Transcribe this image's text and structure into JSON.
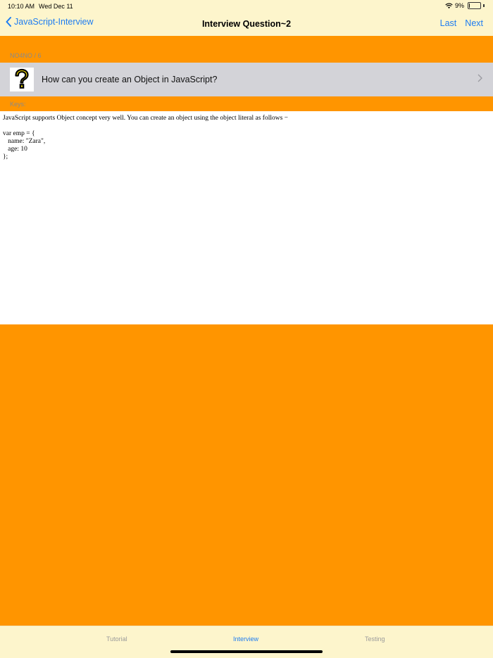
{
  "status": {
    "time": "10:10 AM",
    "date": "Wed Dec 11",
    "battery": "9%",
    "battery_level": 0.09
  },
  "nav": {
    "back_label": "JavaScript-Interview",
    "title": "Interview Question~2",
    "last_label": "Last",
    "next_label": "Next"
  },
  "section": {
    "counter": "NO4NO / 6",
    "keys_label": "Keys:"
  },
  "question": {
    "text": "How can you create an Object in JavaScript?",
    "icon": "question-mark-icon"
  },
  "answer": {
    "text": "JavaScript supports Object concept very well. You can create an object using the object literal as follows −\n\nvar emp = {\n   name: \"Zara\",\n   age: 10\n};"
  },
  "tabs": [
    {
      "label": "Tutorial",
      "active": false
    },
    {
      "label": "Interview",
      "active": true
    },
    {
      "label": "Testing",
      "active": false
    }
  ],
  "colors": {
    "accent": "#1d7cf2",
    "background": "#fdf5cc",
    "orange": "#ff9500",
    "row": "#d3d3d8"
  }
}
